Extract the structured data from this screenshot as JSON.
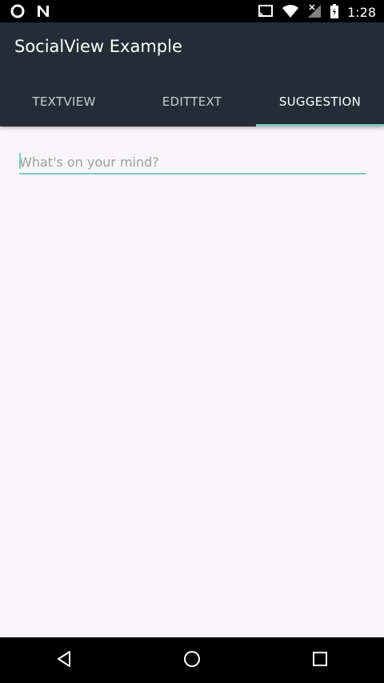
{
  "status_bar": {
    "time": "1:28",
    "left_icons": [
      "circle-notification-icon",
      "n-notification-icon"
    ],
    "right_icons": [
      "cast-icon",
      "wifi-icon",
      "no-signal-icon",
      "battery-charging-icon"
    ]
  },
  "toolbar": {
    "title": "SocialView Example"
  },
  "tabs": [
    {
      "label": "TEXTVIEW",
      "active": false
    },
    {
      "label": "EDITTEXT",
      "active": false
    },
    {
      "label": "SUGGESTION",
      "active": true
    }
  ],
  "input": {
    "placeholder": "What's on your mind?",
    "value": ""
  },
  "nav_bar": {
    "buttons": [
      "back-icon",
      "home-icon",
      "recents-icon"
    ]
  },
  "colors": {
    "primary": "#242D37",
    "accent": "#80CBC4",
    "background": "#F7F5F8"
  }
}
